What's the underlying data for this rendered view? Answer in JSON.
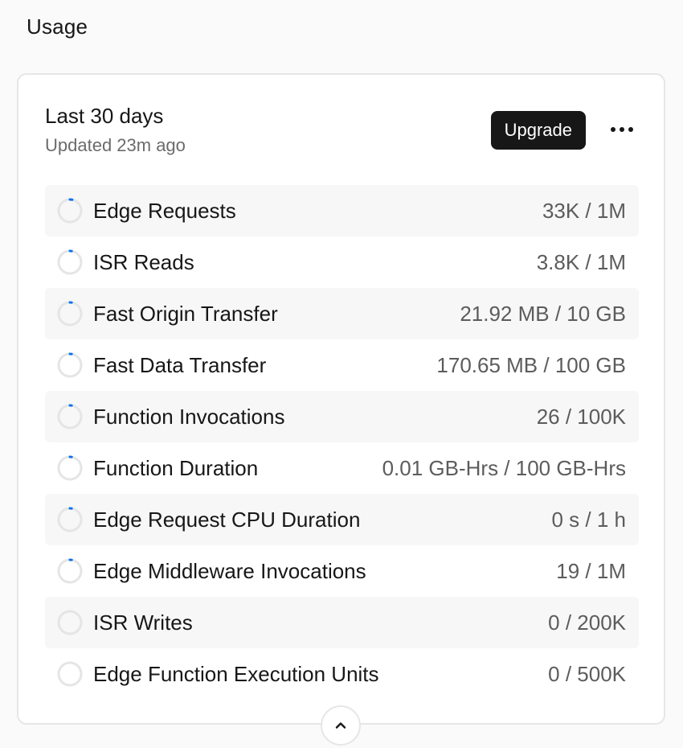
{
  "section": {
    "title": "Usage"
  },
  "card": {
    "period_title": "Last 30 days",
    "updated_text": "Updated 23m ago",
    "upgrade_label": "Upgrade",
    "more_icon": "more-horizontal-icon",
    "collapse_icon": "chevron-up-icon"
  },
  "colors": {
    "progress": "#0a72ef",
    "ring_track": "#e5e5e5",
    "button_bg": "#171717"
  },
  "usage_items": [
    {
      "label": "Edge Requests",
      "value": "33K / 1M",
      "progress": 0.033
    },
    {
      "label": "ISR Reads",
      "value": "3.8K / 1M",
      "progress": 0.0038
    },
    {
      "label": "Fast Origin Transfer",
      "value": "21.92 MB / 10 GB",
      "progress": 0.0021
    },
    {
      "label": "Fast Data Transfer",
      "value": "170.65 MB / 100 GB",
      "progress": 0.0017
    },
    {
      "label": "Function Invocations",
      "value": "26 / 100K",
      "progress": 0.0003
    },
    {
      "label": "Function Duration",
      "value": "0.01 GB-Hrs / 100 GB-Hrs",
      "progress": 0.0001
    },
    {
      "label": "Edge Request CPU Duration",
      "value": "0 s / 1 h",
      "progress": 0.0001
    },
    {
      "label": "Edge Middleware Invocations",
      "value": "19 / 1M",
      "progress": 2e-05
    },
    {
      "label": "ISR Writes",
      "value": "0 / 200K",
      "progress": 0
    },
    {
      "label": "Edge Function Execution Units",
      "value": "0 / 500K",
      "progress": 0
    }
  ]
}
